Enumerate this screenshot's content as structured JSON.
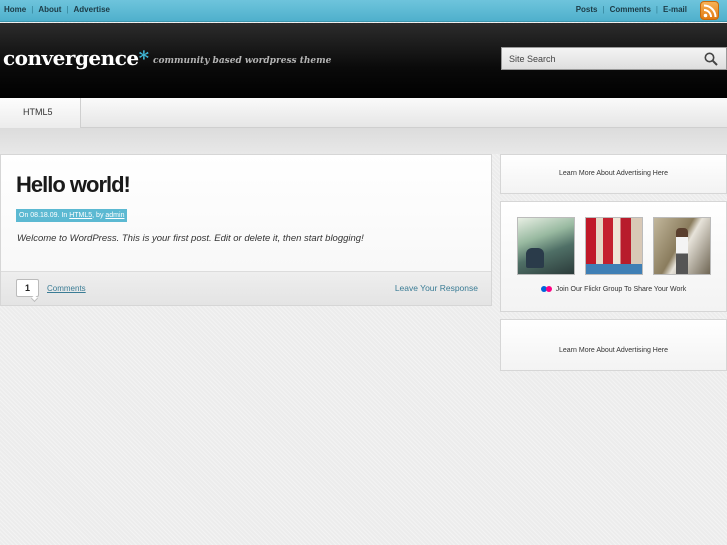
{
  "topbar": {
    "left_nav": [
      "Home",
      "About",
      "Advertise"
    ],
    "right_nav": [
      "Posts",
      "Comments",
      "E-mail"
    ],
    "rss_icon": "rss-feed-icon"
  },
  "header": {
    "logo_text": "convergence",
    "logo_star": "*",
    "tagline": "community based wordpress theme",
    "search_placeholder": "Site Search",
    "search_icon": "magnifier-icon"
  },
  "nav": {
    "tabs": [
      "HTML5"
    ]
  },
  "post": {
    "title": "Hello world!",
    "meta_prefix": "On 08.18.09. In ",
    "meta_category": "HTML5",
    "meta_by": ", by ",
    "meta_author": "admin",
    "excerpt": "Welcome to WordPress. This is your first post. Edit or delete it, then start blogging!",
    "comment_count": "1",
    "comments_label": "Comments",
    "respond_label": "Leave Your Response"
  },
  "sidebar": {
    "ad_top": "Learn More About Advertising Here",
    "flickr_label": "Join Our Flickr Group To Share Your Work",
    "ad_bottom": "Learn More About Advertising Here"
  },
  "colors": {
    "accent": "#5cb9d2",
    "link": "#3a7c95",
    "header_bg": "#0a0a0a"
  }
}
